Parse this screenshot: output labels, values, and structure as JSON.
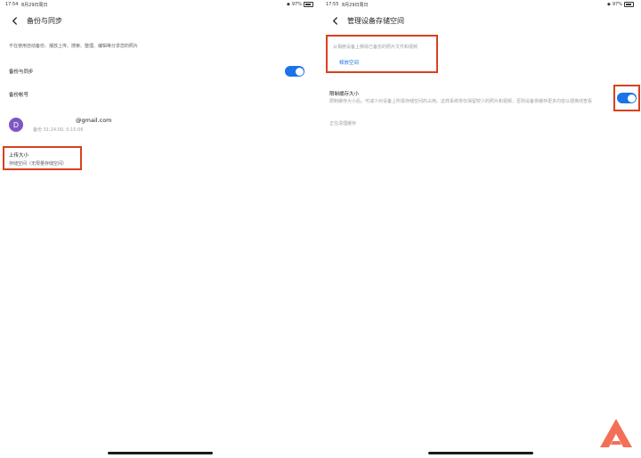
{
  "left": {
    "status": {
      "time": "17:54",
      "date": "8月29日周日",
      "battery": "97%"
    },
    "header": {
      "title": "备份与同步"
    },
    "description": "不在使用自动备份、播放上传、搜索、整理、编辑等分享您的照片",
    "backup_label": "备份与同步",
    "account_heading": "备份帐号",
    "account": {
      "avatar_letter": "D",
      "email": "@gmail.com",
      "last_backup": "备份 31:24:00, 0:15:06"
    },
    "upload": {
      "title": "上传大小",
      "subtitle": "存储空间（无限量存储空间）"
    }
  },
  "right": {
    "status": {
      "time": "17:55",
      "date": "8月29日周日",
      "battery": "97%"
    },
    "header": {
      "title": "管理设备存储空间"
    },
    "free_up": {
      "text": "从相册设备上移除已备份的照片文件和视频",
      "button": "释放空间"
    },
    "cache": {
      "title": "限制缓存大小",
      "description": "限制缓存大小后，可减少对设备上所需存储空间的占用。这样系统将仅保留较少的照片和视频，否则设备将缓存更多内容以便离线查看"
    },
    "cleanup": "正在清理缓存"
  },
  "colors": {
    "accent": "#1a73e8",
    "highlight": "#d9411e",
    "avatar": "#7e57c2",
    "logo": "#f37058"
  }
}
